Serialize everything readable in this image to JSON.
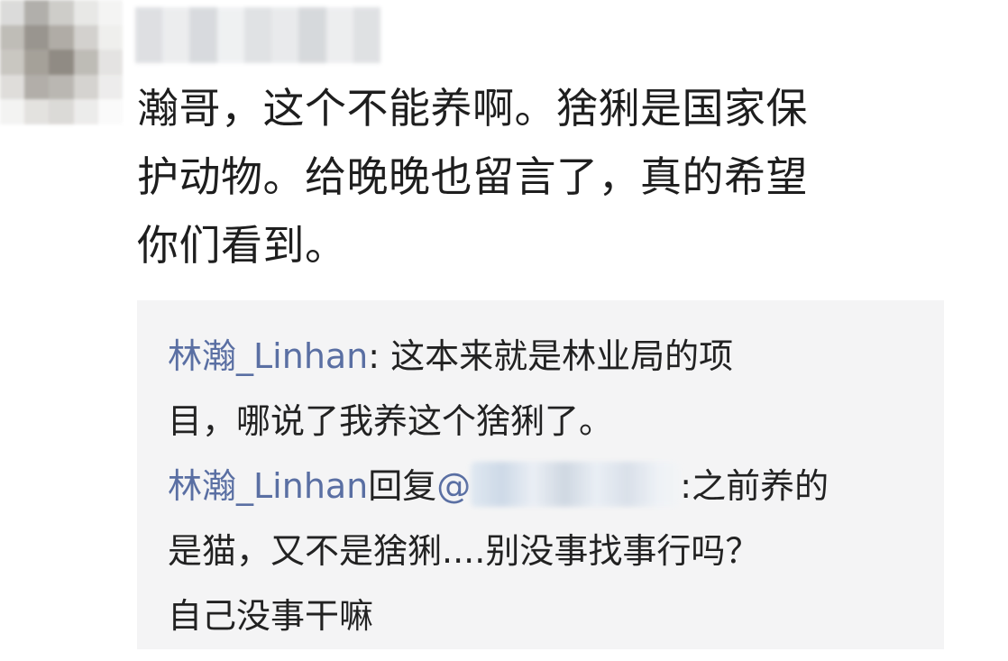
{
  "comment": {
    "line1": "瀚哥，这个不能养啊。猞猁是国家保",
    "line2": "护动物。给晚晚也留言了，真的希望",
    "line3": "你们看到。"
  },
  "replies": [
    {
      "author": "林瀚_Linhan",
      "separator": ":",
      "line1": " 这本来就是林业局的项",
      "line2": "目，哪说了我养这个猞猁了。"
    },
    {
      "author": "林瀚_Linhan",
      "reply_word": "回复",
      "mention_prefix": "@",
      "after_mention": ":之前养的",
      "line2": "是猫，又不是猞猁....别没事找事行吗？",
      "line3": "自己没事干嘛"
    }
  ],
  "colors": {
    "author": "#5a6fa3",
    "text": "#1e1e1e",
    "reply_bg": "#f4f4f5"
  }
}
